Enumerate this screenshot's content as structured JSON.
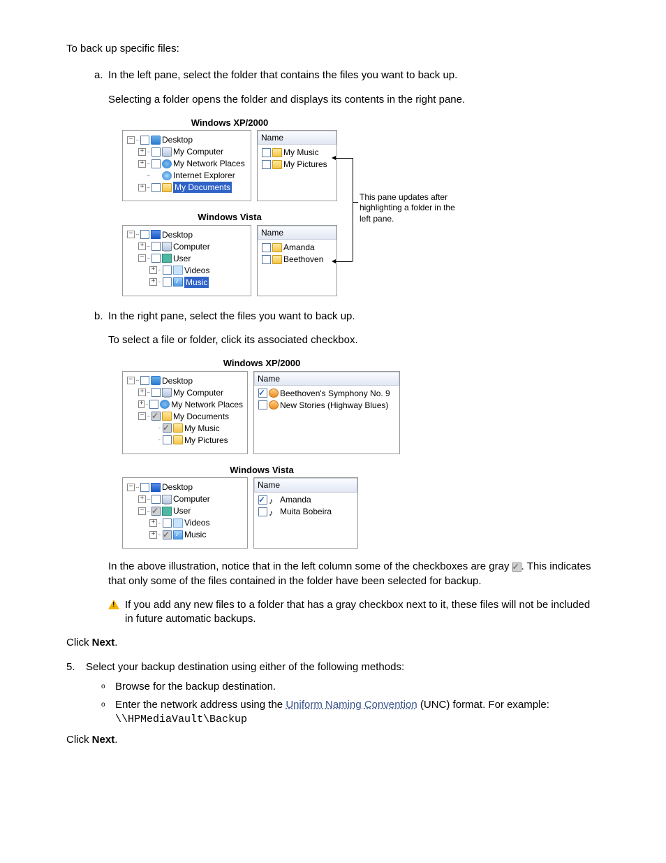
{
  "intro": "To back up specific files:",
  "step_a": {
    "marker": "a.",
    "p1": "In the left pane, select the folder that contains the files you want to back up.",
    "p2": "Selecting a folder opens the folder and displays its contents in the right pane."
  },
  "fig1": {
    "xp_title": "Windows XP/2000",
    "vista_title": "Windows Vista",
    "name_header": "Name",
    "xp_tree": {
      "desktop": "Desktop",
      "mycomputer": "My Computer",
      "mynetwork": "My Network Places",
      "ie": "Internet Explorer",
      "mydocs": "My Documents"
    },
    "xp_files": {
      "f1": "My Music",
      "f2": "My Pictures"
    },
    "vista_tree": {
      "desktop": "Desktop",
      "computer": "Computer",
      "user": "User",
      "videos": "Videos",
      "music": "Music"
    },
    "vista_files": {
      "f1": "Amanda",
      "f2": "Beethoven"
    },
    "annotation": "This pane updates after highlighting a folder in the left pane."
  },
  "step_b": {
    "marker": "b.",
    "p1": "In the right pane, select the files you want to back up.",
    "p2": "To select a file or folder, click its associated checkbox."
  },
  "fig2": {
    "xp_title": "Windows XP/2000",
    "vista_title": "Windows Vista",
    "name_header": "Name",
    "xp_tree": {
      "desktop": "Desktop",
      "mycomputer": "My Computer",
      "mynetwork": "My Network Places",
      "mydocs": "My Documents",
      "mymusic": "My Music",
      "mypics": "My Pictures"
    },
    "xp_files": {
      "f1": "Beethoven's Symphony No. 9",
      "f2": "New Stories (Highway Blues)"
    },
    "vista_tree": {
      "desktop": "Desktop",
      "computer": "Computer",
      "user": "User",
      "videos": "Videos",
      "music": "Music"
    },
    "vista_files": {
      "f1": "Amanda",
      "f2": "Muita Bobeira"
    }
  },
  "note_gray1": "In the above illustration, notice that in the left column some of the checkboxes are gray ",
  "note_gray2": ". This indicates that only some of the files contained in the folder have been selected for backup.",
  "warn": "If you add any new files to a folder that has a gray checkbox next to it, these files will not be included in future automatic backups.",
  "click_next_prefix": "Click ",
  "click_next_bold": "Next",
  "click_next_suffix": ".",
  "step5": {
    "num": "5.",
    "p1": "Select your backup destination using either of the following methods:",
    "b1": "Browse for the backup destination.",
    "b2a": "Enter the network address using the ",
    "b2link": "Uniform Naming Convention",
    "b2b": " (UNC) format. For example: ",
    "b2code": "\\\\HPMediaVault\\Backup"
  }
}
